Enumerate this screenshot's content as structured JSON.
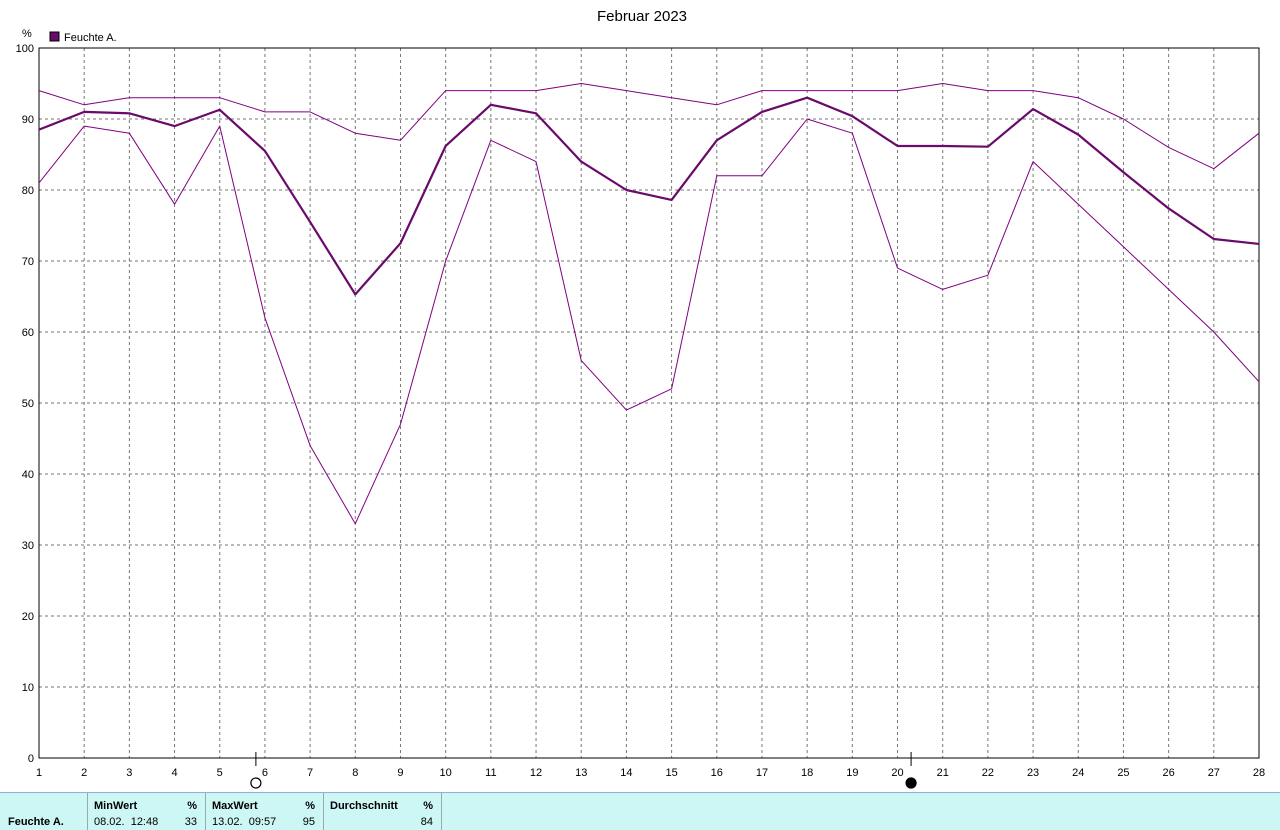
{
  "chart_data": {
    "type": "line",
    "title": "Februar 2023",
    "ylabel": "%",
    "ylim": [
      0,
      100
    ],
    "yticks": [
      0,
      10,
      20,
      30,
      40,
      50,
      60,
      70,
      80,
      90,
      100
    ],
    "x": [
      1,
      2,
      3,
      4,
      5,
      6,
      7,
      8,
      9,
      10,
      11,
      12,
      13,
      14,
      15,
      16,
      17,
      18,
      19,
      20,
      21,
      22,
      23,
      24,
      25,
      26,
      27,
      28
    ],
    "xlim": [
      1,
      28
    ],
    "grid": true,
    "legend": {
      "position": "top-left",
      "entries": [
        "Feuchte A."
      ]
    },
    "series": [
      {
        "name": "Feuchte A.",
        "role": "avg",
        "color": "#6a0a6a",
        "values": [
          88.5,
          91,
          90.8,
          89,
          91.3,
          85.5,
          75.5,
          65.3,
          72.5,
          86.2,
          92,
          90.8,
          84,
          80,
          78.6,
          87,
          91,
          93,
          90.4,
          86.2,
          86.2,
          86.1,
          91.4,
          87.8,
          82.5,
          77.4,
          73.1,
          72.4
        ]
      },
      {
        "role": "max",
        "color": "#800080",
        "values": [
          94,
          92,
          93,
          93,
          93,
          91,
          91,
          88,
          87,
          94,
          94,
          94,
          95,
          94,
          93,
          92,
          94,
          94,
          94,
          94,
          95,
          94,
          94,
          93,
          90,
          86,
          83,
          88
        ]
      },
      {
        "role": "min",
        "color": "#800080",
        "values": [
          81,
          89,
          88,
          78,
          89,
          62,
          44,
          33,
          47,
          70,
          87,
          84,
          56,
          49,
          52,
          82,
          82,
          90,
          88,
          69,
          66,
          68,
          84,
          78,
          72,
          66,
          60,
          53
        ]
      }
    ],
    "moon_phases": [
      {
        "x": 5.8,
        "phase": "full"
      },
      {
        "x": 20.3,
        "phase": "new"
      }
    ]
  },
  "stats": {
    "row_label": "Feuchte A.",
    "min": {
      "header": "MinWert",
      "unit": "%",
      "datetime": "08.02.  12:48",
      "value": "33"
    },
    "max": {
      "header": "MaxWert",
      "unit": "%",
      "datetime": "13.02.  09:57",
      "value": "95"
    },
    "avg": {
      "header": "Durchschnitt",
      "unit": "%",
      "value": "84"
    }
  }
}
